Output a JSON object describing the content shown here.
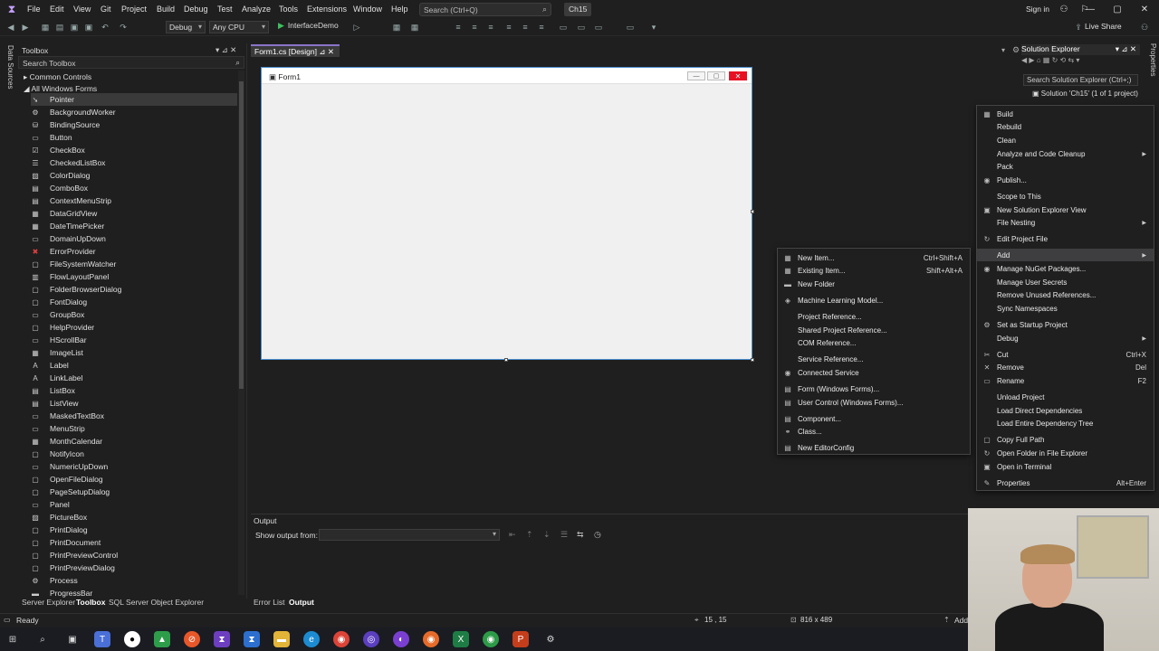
{
  "titlebar": {
    "menus": [
      "File",
      "Edit",
      "View",
      "Git",
      "Project",
      "Build",
      "Debug",
      "Test",
      "Analyze",
      "Tools",
      "Extensions",
      "Window",
      "Help"
    ],
    "search_placeholder": "Search (Ctrl+Q)",
    "solution_name": "Ch15",
    "sign_in": "Sign in"
  },
  "toolbar": {
    "config": "Debug",
    "platform": "Any CPU",
    "run_target": "InterfaceDemo",
    "live_share": "Live Share"
  },
  "left_vertical_tab": "Data Sources",
  "toolbox": {
    "title": "Toolbox",
    "search_placeholder": "Search Toolbox",
    "categories": [
      "Common Controls",
      "All Windows Forms"
    ],
    "items": [
      {
        "label": "Pointer",
        "icon": "pointer-icon",
        "glyph": "➘",
        "selected": true
      },
      {
        "label": "BackgroundWorker",
        "icon": "background-worker-icon",
        "glyph": "⚙"
      },
      {
        "label": "BindingSource",
        "icon": "binding-source-icon",
        "glyph": "⛁"
      },
      {
        "label": "Button",
        "icon": "button-icon",
        "glyph": "▭"
      },
      {
        "label": "CheckBox",
        "icon": "checkbox-icon",
        "glyph": "☑"
      },
      {
        "label": "CheckedListBox",
        "icon": "checked-listbox-icon",
        "glyph": "☰"
      },
      {
        "label": "ColorDialog",
        "icon": "color-dialog-icon",
        "glyph": "▨"
      },
      {
        "label": "ComboBox",
        "icon": "combobox-icon",
        "glyph": "▤"
      },
      {
        "label": "ContextMenuStrip",
        "icon": "context-menu-icon",
        "glyph": "▤"
      },
      {
        "label": "DataGridView",
        "icon": "data-grid-icon",
        "glyph": "▦"
      },
      {
        "label": "DateTimePicker",
        "icon": "date-picker-icon",
        "glyph": "▦"
      },
      {
        "label": "DomainUpDown",
        "icon": "domain-updown-icon",
        "glyph": "▭"
      },
      {
        "label": "ErrorProvider",
        "icon": "error-provider-icon",
        "glyph": "✖"
      },
      {
        "label": "FileSystemWatcher",
        "icon": "file-watcher-icon",
        "glyph": "▢"
      },
      {
        "label": "FlowLayoutPanel",
        "icon": "flow-layout-icon",
        "glyph": "▥"
      },
      {
        "label": "FolderBrowserDialog",
        "icon": "folder-browser-icon",
        "glyph": "▢"
      },
      {
        "label": "FontDialog",
        "icon": "font-dialog-icon",
        "glyph": "▢"
      },
      {
        "label": "GroupBox",
        "icon": "groupbox-icon",
        "glyph": "▭"
      },
      {
        "label": "HelpProvider",
        "icon": "help-provider-icon",
        "glyph": "▢"
      },
      {
        "label": "HScrollBar",
        "icon": "hscrollbar-icon",
        "glyph": "▭"
      },
      {
        "label": "ImageList",
        "icon": "imagelist-icon",
        "glyph": "▦"
      },
      {
        "label": "Label",
        "icon": "label-icon",
        "glyph": "A"
      },
      {
        "label": "LinkLabel",
        "icon": "linklabel-icon",
        "glyph": "A"
      },
      {
        "label": "ListBox",
        "icon": "listbox-icon",
        "glyph": "▤"
      },
      {
        "label": "ListView",
        "icon": "listview-icon",
        "glyph": "▤"
      },
      {
        "label": "MaskedTextBox",
        "icon": "masked-textbox-icon",
        "glyph": "▭"
      },
      {
        "label": "MenuStrip",
        "icon": "menustrip-icon",
        "glyph": "▭"
      },
      {
        "label": "MonthCalendar",
        "icon": "month-calendar-icon",
        "glyph": "▦"
      },
      {
        "label": "NotifyIcon",
        "icon": "notify-icon",
        "glyph": "▢"
      },
      {
        "label": "NumericUpDown",
        "icon": "numeric-updown-icon",
        "glyph": "▭"
      },
      {
        "label": "OpenFileDialog",
        "icon": "open-file-dialog-icon",
        "glyph": "▢"
      },
      {
        "label": "PageSetupDialog",
        "icon": "page-setup-icon",
        "glyph": "▢"
      },
      {
        "label": "Panel",
        "icon": "panel-icon",
        "glyph": "▭"
      },
      {
        "label": "PictureBox",
        "icon": "picturebox-icon",
        "glyph": "▨"
      },
      {
        "label": "PrintDialog",
        "icon": "print-dialog-icon",
        "glyph": "▢"
      },
      {
        "label": "PrintDocument",
        "icon": "print-document-icon",
        "glyph": "▢"
      },
      {
        "label": "PrintPreviewControl",
        "icon": "print-preview-control-icon",
        "glyph": "▢"
      },
      {
        "label": "PrintPreviewDialog",
        "icon": "print-preview-dialog-icon",
        "glyph": "▢"
      },
      {
        "label": "Process",
        "icon": "process-icon",
        "glyph": "⚙"
      },
      {
        "label": "ProgressBar",
        "icon": "progressbar-icon",
        "glyph": "▬"
      }
    ]
  },
  "bottom_tabs": [
    "Server Explorer",
    "Toolbox",
    "SQL Server Object Explorer"
  ],
  "document_tab": "Form1.cs [Design]",
  "form": {
    "caption": "Form1"
  },
  "output": {
    "title": "Output",
    "show_from_label": "Show output from:"
  },
  "bottom_tabs_center": [
    "Error List",
    "Output"
  ],
  "solution_explorer": {
    "title": "Solution Explorer",
    "search_placeholder": "Search Solution Explorer (Ctrl+;)",
    "solution_label": "Solution 'Ch15' (1 of 1 project)"
  },
  "right_vertical_tab": "Properties",
  "main_menu": [
    {
      "label": "Build",
      "icon": "build-icon",
      "glyph": "▦"
    },
    {
      "label": "Rebuild"
    },
    {
      "label": "Clean"
    },
    {
      "label": "Analyze and Code Cleanup",
      "submenu": true
    },
    {
      "label": "Pack"
    },
    {
      "label": "Publish...",
      "icon": "publish-icon",
      "glyph": "◉"
    },
    {
      "label": "Scope to This"
    },
    {
      "label": "New Solution Explorer View",
      "icon": "new-view-icon",
      "glyph": "▣"
    },
    {
      "label": "File Nesting",
      "submenu": true
    },
    {
      "label": "Edit Project File",
      "icon": "edit-file-icon",
      "glyph": "↻"
    },
    {
      "label": "Add",
      "submenu": true,
      "highlight": true
    },
    {
      "label": "Manage NuGet Packages...",
      "icon": "nuget-icon",
      "glyph": "◉"
    },
    {
      "label": "Manage User Secrets"
    },
    {
      "label": "Remove Unused References..."
    },
    {
      "label": "Sync Namespaces"
    },
    {
      "label": "Set as Startup Project",
      "icon": "gear-icon",
      "glyph": "⚙"
    },
    {
      "label": "Debug",
      "submenu": true
    },
    {
      "label": "Cut",
      "icon": "cut-icon",
      "glyph": "✂",
      "shortcut": "Ctrl+X"
    },
    {
      "label": "Remove",
      "icon": "remove-icon",
      "glyph": "✕",
      "shortcut": "Del"
    },
    {
      "label": "Rename",
      "icon": "rename-icon",
      "glyph": "▭",
      "shortcut": "F2"
    },
    {
      "label": "Unload Project"
    },
    {
      "label": "Load Direct Dependencies"
    },
    {
      "label": "Load Entire Dependency Tree"
    },
    {
      "label": "Copy Full Path",
      "icon": "copy-path-icon",
      "glyph": "▢"
    },
    {
      "label": "Open Folder in File Explorer",
      "icon": "folder-icon",
      "glyph": "↻"
    },
    {
      "label": "Open in Terminal",
      "icon": "terminal-icon",
      "glyph": "▣"
    },
    {
      "label": "Properties",
      "icon": "wrench-icon",
      "glyph": "✎",
      "shortcut": "Alt+Enter"
    }
  ],
  "add_menu": [
    {
      "label": "New Item...",
      "icon": "new-item-icon",
      "glyph": "▦",
      "shortcut": "Ctrl+Shift+A"
    },
    {
      "label": "Existing Item...",
      "icon": "existing-item-icon",
      "glyph": "▦",
      "shortcut": "Shift+Alt+A"
    },
    {
      "label": "New Folder",
      "icon": "new-folder-icon",
      "glyph": "▬"
    },
    {
      "label": "Machine Learning Model...",
      "icon": "ml-model-icon",
      "glyph": "◈"
    },
    {
      "label": "Project Reference..."
    },
    {
      "label": "Shared Project Reference..."
    },
    {
      "label": "COM Reference..."
    },
    {
      "label": "Service Reference..."
    },
    {
      "label": "Connected Service",
      "icon": "connected-service-icon",
      "glyph": "◉"
    },
    {
      "label": "Form (Windows Forms)...",
      "icon": "form-icon",
      "glyph": "▤"
    },
    {
      "label": "User Control (Windows Forms)...",
      "icon": "user-control-icon",
      "glyph": "▤"
    },
    {
      "label": "Component...",
      "icon": "component-icon",
      "glyph": "▤"
    },
    {
      "label": "Class...",
      "icon": "class-icon",
      "glyph": "⚭"
    },
    {
      "label": "New EditorConfig",
      "icon": "editorconfig-icon",
      "glyph": "▤"
    }
  ],
  "statusbar": {
    "ready": "Ready",
    "position": "15 , 15",
    "size": "816 x 489",
    "add": "Add"
  },
  "colors": {
    "accent": "#8a74c9",
    "background": "#1f1f1f",
    "close_red": "#e81123"
  }
}
